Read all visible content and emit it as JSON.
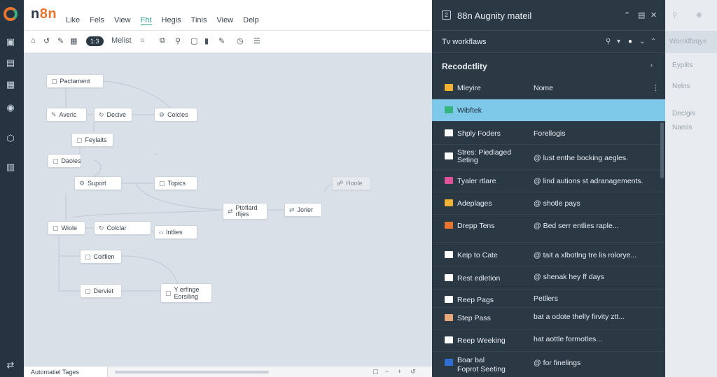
{
  "app": {
    "brand_prefix": "n",
    "brand_accent": "8n"
  },
  "menu": [
    "Like",
    "Fels",
    "View",
    "Fht",
    "Hegis",
    "Tinis",
    "View",
    "Delp"
  ],
  "toolbar": {
    "badge": "1:3",
    "label": "Melist"
  },
  "canvas": {
    "nodes": [
      {
        "label": "Pactament",
        "icon": "doc-icon"
      },
      {
        "label": "Averic",
        "icon": "edit-icon"
      },
      {
        "label": "Decive",
        "icon": "refresh-icon"
      },
      {
        "label": "Colcles",
        "icon": "gear-icon"
      },
      {
        "label": "Feylaits",
        "icon": "doc-icon"
      },
      {
        "label": "Daoles",
        "icon": "doc-icon"
      },
      {
        "label": "Suport",
        "icon": "gear-icon"
      },
      {
        "label": "Topics",
        "icon": "doc-icon"
      },
      {
        "label": "Hoole",
        "icon": "link-icon"
      },
      {
        "label": "Ptoflard\nrfijes",
        "icon": "share-icon"
      },
      {
        "label": "Jorler",
        "icon": "share-icon"
      },
      {
        "label": "Wiole",
        "icon": "doc-icon"
      },
      {
        "label": "Colclar",
        "icon": "refresh-icon"
      },
      {
        "label": "Intlies",
        "icon": "code-icon"
      },
      {
        "label": "Coifllen",
        "icon": "doc-icon"
      },
      {
        "label": "Derviet",
        "icon": "doc-icon"
      },
      {
        "label": "Y erfinge\nEorsiling",
        "icon": "doc-icon"
      }
    ]
  },
  "bottombar": {
    "tag": "Automatiel Tages"
  },
  "panel": {
    "badge": "2",
    "title": "88n Augnity mateil",
    "subtitle": "Tv workflaws",
    "section": "Recodctlity",
    "rows": [
      {
        "name": "Mleyire",
        "col2": "Nome",
        "icon": "folder-icon",
        "color": "#f2b233",
        "dots": true
      },
      {
        "name": "Wibftek",
        "col2": "",
        "icon": "n8n-icon",
        "color": "#36b37e",
        "selected": true
      },
      {
        "name": "Shply Foders",
        "col2": "Forellogis",
        "icon": "square-icon",
        "color": "#ffffff"
      },
      {
        "name": "Stres: Piedlaged\nSeting",
        "col2": "@ lust enthe bocking aegles.",
        "icon": "square-icon",
        "color": "#ffffff"
      },
      {
        "name": "Tyaler rtlare",
        "col2": "@ lind autions st adranagements.",
        "icon": "pink-icon",
        "color": "#e0529a"
      },
      {
        "name": "Adeplages",
        "col2": "@ shotle pays",
        "icon": "folder-icon",
        "color": "#f2b233"
      },
      {
        "name": "Drepp Tens",
        "col2": "@ Bed serr entlies raple...",
        "icon": "orange-icon",
        "color": "#e8752f"
      },
      {
        "name": "Keip to Cate",
        "col2": "@ tait a xlbotlng tre lis rolorye...",
        "icon": "square-icon",
        "color": "#ffffff"
      },
      {
        "name": "Rest edletion",
        "col2": "@ shenak hey ff days",
        "icon": "square-icon",
        "color": "#ffffff"
      },
      {
        "name": "Reep Pags",
        "col2": "Petllers",
        "icon": "square-icon",
        "color": "#ffffff"
      },
      {
        "name": "Step Pass",
        "col2": "bat a odote thelly firvity ztt...",
        "icon": "pattern-icon",
        "color": "#e8a87c"
      },
      {
        "name": "Reep Weeking",
        "col2": "hat aottle formotles...",
        "icon": "square-icon",
        "color": "#ffffff"
      },
      {
        "name": "Boar bal\nFoprot Seeting",
        "col2": "@ for finelings",
        "icon": "blue-icon",
        "color": "#2f6fd6"
      }
    ]
  },
  "right_faded": [
    "Worrkffaqys",
    "Eyplits",
    "Nelns",
    "Declgis",
    "Namls"
  ]
}
